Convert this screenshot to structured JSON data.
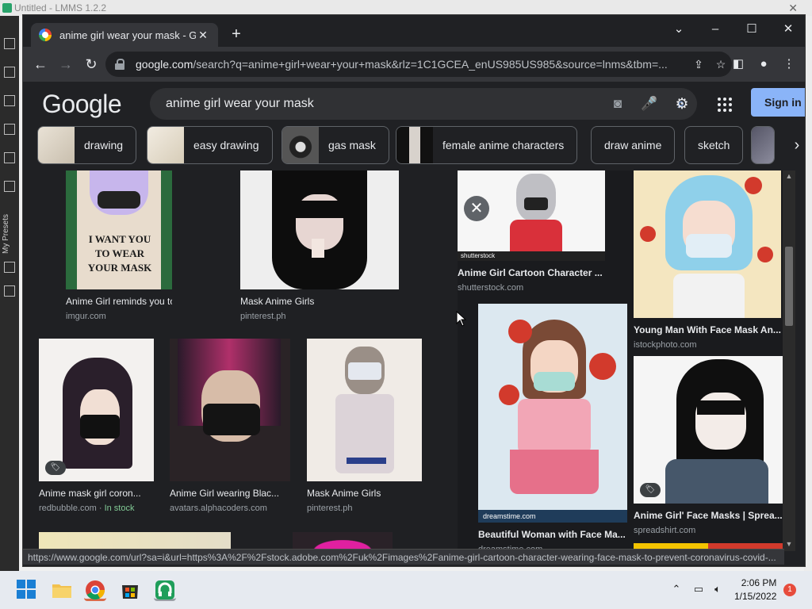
{
  "background_app": {
    "title": "Untitled - LMMS 1.2.2",
    "side_label": "My Presets"
  },
  "browser": {
    "tab_title": "anime girl wear your mask - Google Search",
    "url_domain": "google.com",
    "url_path": "/search?q=anime+girl+wear+your+mask&rlz=1C1GCEA_enUS985US985&source=lnms&tbm=...",
    "status_url": "https://www.google.com/url?sa=i&url=https%3A%2F%2Fstock.adobe.com%2Fuk%2Fimages%2Fanime-girl-cartoon-character-wearing-face-mask-to-prevent-coronavirus-covid-..."
  },
  "google": {
    "logo": "Google",
    "query": "anime girl wear your mask",
    "signin_label": "Sign in"
  },
  "chips": [
    {
      "label": "drawing"
    },
    {
      "label": "easy drawing"
    },
    {
      "label": "gas mask"
    },
    {
      "label": "female anime characters"
    },
    {
      "label": "draw anime"
    },
    {
      "label": "sketch"
    }
  ],
  "results": [
    {
      "title": "Anime Girl reminds you to wear y...",
      "source": "imgur.com",
      "poster_text": "I WANT YOU TO WEAR YOUR MASK"
    },
    {
      "title": "Mask Anime Girls",
      "source": "pinterest.ph"
    },
    {
      "title": "Anime mask girl coron...",
      "source": "redbubble.com",
      "stock": "In stock"
    },
    {
      "title": "Anime Girl wearing Blac...",
      "source": "avatars.alphacoders.com"
    },
    {
      "title": "Mask Anime Girls",
      "source": "pinterest.ph"
    }
  ],
  "panel_results": [
    {
      "title": "Anime Girl Cartoon Character ...",
      "source": "shutterstock.com",
      "watermark": "shutterstock"
    },
    {
      "title": "Young Man With Face Mask An...",
      "source": "istockphoto.com"
    },
    {
      "title": "Beautiful Woman with Face Ma...",
      "source": "dreamstime.com",
      "watermark": "dreamstime.com"
    },
    {
      "title": "Anime Girl' Face Masks | Sprea...",
      "source": "spreadshirt.com"
    }
  ],
  "taskbar": {
    "time": "2:06 PM",
    "date": "1/15/2022",
    "notifications": "1"
  }
}
